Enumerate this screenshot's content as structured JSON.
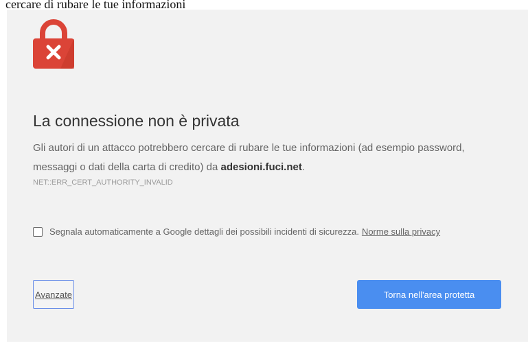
{
  "header_caption": "cercare di rubare le tue informazioni",
  "error_page": {
    "title": "La connessione non è privata",
    "message_prefix": "Gli autori di un attacco potrebbero cercare di rubare le tue informazioni (ad esempio password, messaggi o dati della carta di credito) da ",
    "host": "adesioni.fuci.net",
    "message_suffix": ".",
    "error_code": "NET::ERR_CERT_AUTHORITY_INVALID",
    "report_label": "Segnala automaticamente a Google dettagli dei possibili incidenti di sicurezza.",
    "privacy_link": "Norme sulla privacy",
    "report_checked": false,
    "advanced_label": "Avanzate",
    "back_label": "Torna nell'area protetta"
  },
  "icons": {
    "lock": "lock-icon",
    "cross": "close-icon"
  },
  "colors": {
    "page_background": "#f2f2f2",
    "lock_red": "#db4437",
    "primary_button": "#4a8ef0",
    "focus_border": "#6b8fe8"
  }
}
